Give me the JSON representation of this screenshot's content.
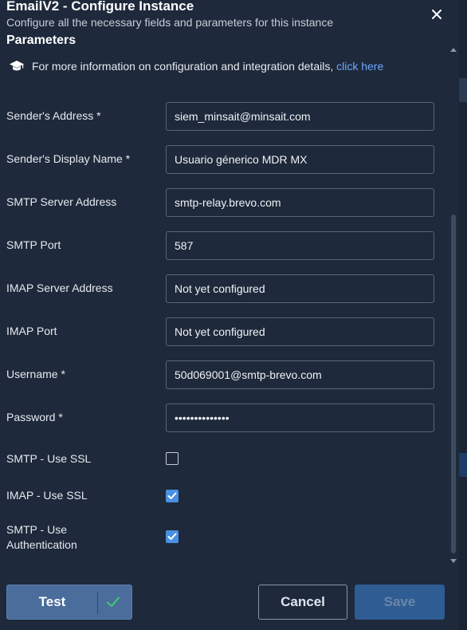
{
  "dialog": {
    "title": "EmailV2 - Configure Instance",
    "subtitle": "Configure all the necessary fields and parameters for this instance",
    "close_icon": "close-icon"
  },
  "parameters": {
    "section_title": "Parameters",
    "info_icon": "graduation-cap-icon",
    "info_text": "For more information on configuration and integration details, ",
    "info_link": "click here"
  },
  "fields": {
    "sender_address": {
      "label": "Sender's Address *",
      "value": "siem_minsait@minsait.com"
    },
    "sender_display_name": {
      "label": "Sender's Display Name *",
      "value": "Usuario génerico MDR MX"
    },
    "smtp_server": {
      "label": "SMTP Server Address",
      "value": "smtp-relay.brevo.com"
    },
    "smtp_port": {
      "label": "SMTP Port",
      "value": "587"
    },
    "imap_server": {
      "label": "IMAP Server Address",
      "value": "Not yet configured"
    },
    "imap_port": {
      "label": "IMAP Port",
      "value": "Not yet configured"
    },
    "username": {
      "label": "Username *",
      "value": "50d069001@smtp-brevo.com"
    },
    "password": {
      "label": "Password *",
      "value": "••••••••••••••"
    }
  },
  "checkboxes": {
    "smtp_use_ssl": {
      "label": "SMTP - Use SSL",
      "checked": false
    },
    "imap_use_ssl": {
      "label": "IMAP - Use SSL",
      "checked": true
    },
    "smtp_use_auth": {
      "label_line1": "SMTP - Use",
      "label_line2": "Authentication",
      "checked": true
    }
  },
  "footer": {
    "test_label": "Test",
    "cancel_label": "Cancel",
    "save_label": "Save"
  },
  "colors": {
    "dialog_bg": "#1e293b",
    "accent": "#4a90e2",
    "link": "#6fa8ff",
    "test_check": "#3fbf7a"
  }
}
